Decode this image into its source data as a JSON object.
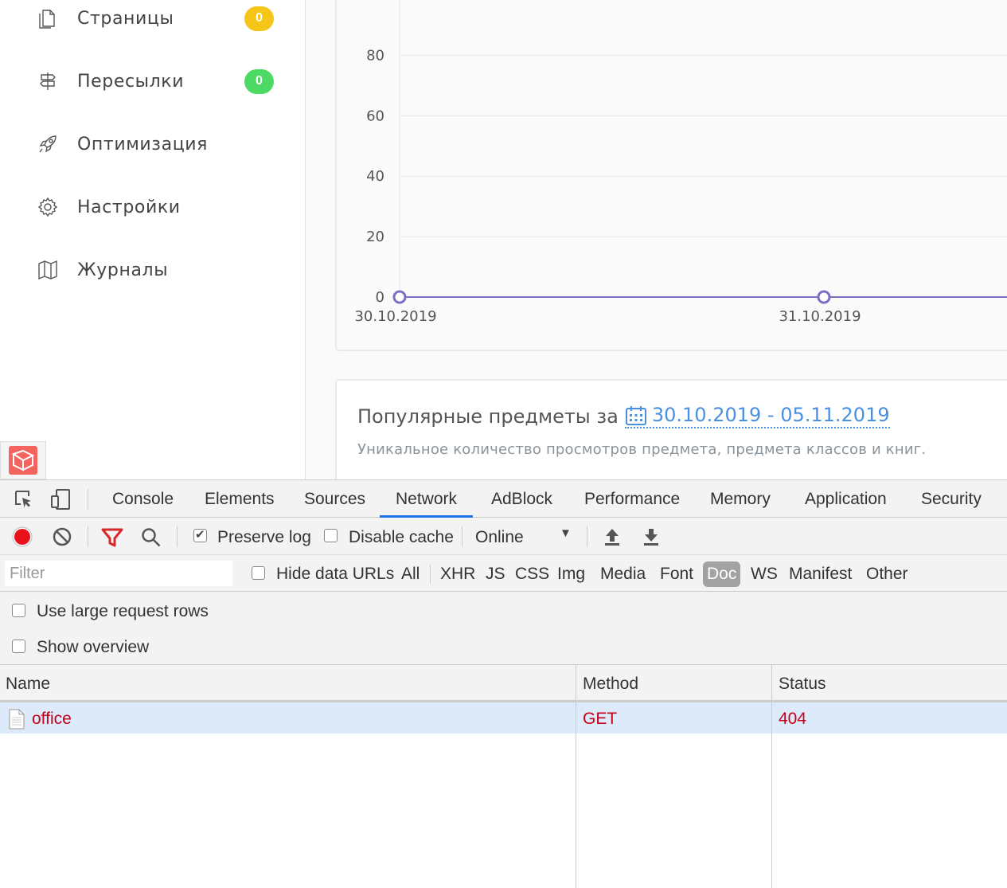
{
  "sidebar": {
    "items": [
      {
        "label": "Страницы",
        "icon": "pages-icon",
        "badge": "0",
        "badge_color": "#f5c518"
      },
      {
        "label": "Пересылки",
        "icon": "signpost-icon",
        "badge": "0",
        "badge_color": "#4cd964"
      },
      {
        "label": "Оптимизация",
        "icon": "rocket-icon"
      },
      {
        "label": "Настройки",
        "icon": "gear-icon"
      },
      {
        "label": "Журналы",
        "icon": "map-icon"
      }
    ]
  },
  "chart_data": {
    "type": "line",
    "x": [
      "30.10.2019",
      "31.10.2019"
    ],
    "series": [
      {
        "values": [
          0,
          0
        ]
      }
    ],
    "yticks": [
      0,
      20,
      40,
      60,
      80
    ],
    "ylim": [
      0,
      100
    ],
    "grid": true,
    "line_color": "#7b6fc4"
  },
  "popular": {
    "title": "Популярные предметы за",
    "range": "30.10.2019 - 05.11.2019",
    "description": "Уникальное количество просмотров предмета, предмета классов и книг."
  },
  "devtools": {
    "tabs": [
      "Console",
      "Elements",
      "Sources",
      "Network",
      "AdBlock",
      "Performance",
      "Memory",
      "Application",
      "Security"
    ],
    "active_tab": "Network",
    "toolbar": {
      "preserve_log": "Preserve log",
      "disable_cache": "Disable cache",
      "throttling": "Online"
    },
    "filter": {
      "placeholder": "Filter",
      "hide_data_urls": "Hide data URLs",
      "types": [
        "All",
        "XHR",
        "JS",
        "CSS",
        "Img",
        "Media",
        "Font",
        "Doc",
        "WS",
        "Manifest",
        "Other"
      ],
      "active_type": "Doc"
    },
    "options": {
      "large_rows": "Use large request rows",
      "overview": "Show overview"
    },
    "table": {
      "columns": [
        "Name",
        "Method",
        "Status"
      ],
      "rows": [
        {
          "name": "office",
          "method": "GET",
          "status": "404"
        }
      ]
    },
    "colors": {
      "record": "#e8121b",
      "filter": "#d9282b",
      "accent": "#1a73e8",
      "error": "#c4001a"
    }
  }
}
